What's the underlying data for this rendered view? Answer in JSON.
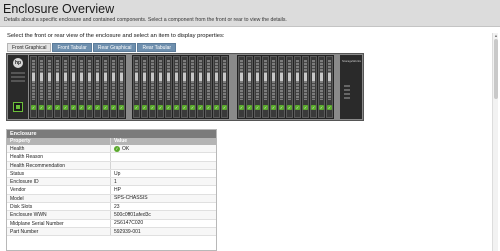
{
  "header": {
    "title": "Enclosure Overview",
    "description": "Details about a specific enclosure and contained components. Select a component from the front or rear to view the details."
  },
  "instructions": "Select the front or rear view of the enclosure and select an item to display properties:",
  "tabs": [
    {
      "label": "Front Graphical",
      "active": true
    },
    {
      "label": "Front Tabular",
      "active": false
    },
    {
      "label": "Rear Graphical",
      "active": false
    },
    {
      "label": "Rear Tabular",
      "active": false
    }
  ],
  "enclosure_graphic": {
    "logo": "hp",
    "right_panel_label": "StorageWorks",
    "bay_groups": [
      12,
      12,
      12
    ],
    "bay_status_icon": "check-icon",
    "colors": {
      "ok": "#5aa92c",
      "tab_active": "#e4e4e4",
      "tab_inactive": "#6e8fae"
    }
  },
  "properties_panel": {
    "title": "Enclosure",
    "columns": [
      "Property",
      "Value"
    ],
    "rows": [
      {
        "property": "Health",
        "value": "OK",
        "icon": "ok-status-icon"
      },
      {
        "property": "Health Reason",
        "value": ""
      },
      {
        "property": "Health Recommendation",
        "value": ""
      },
      {
        "property": "Status",
        "value": "Up"
      },
      {
        "property": "Enclosure ID",
        "value": "1"
      },
      {
        "property": "Vendor",
        "value": "HP"
      },
      {
        "property": "Model",
        "value": "SPS-CHASSIS"
      },
      {
        "property": "Disk Slots",
        "value": "23"
      },
      {
        "property": "Enclosure WWN",
        "value": "500c0ff01afed3c"
      },
      {
        "property": "Midplane Serial Number",
        "value": "2S6147C020"
      },
      {
        "property": "Part Number",
        "value": "592939-001"
      }
    ]
  }
}
